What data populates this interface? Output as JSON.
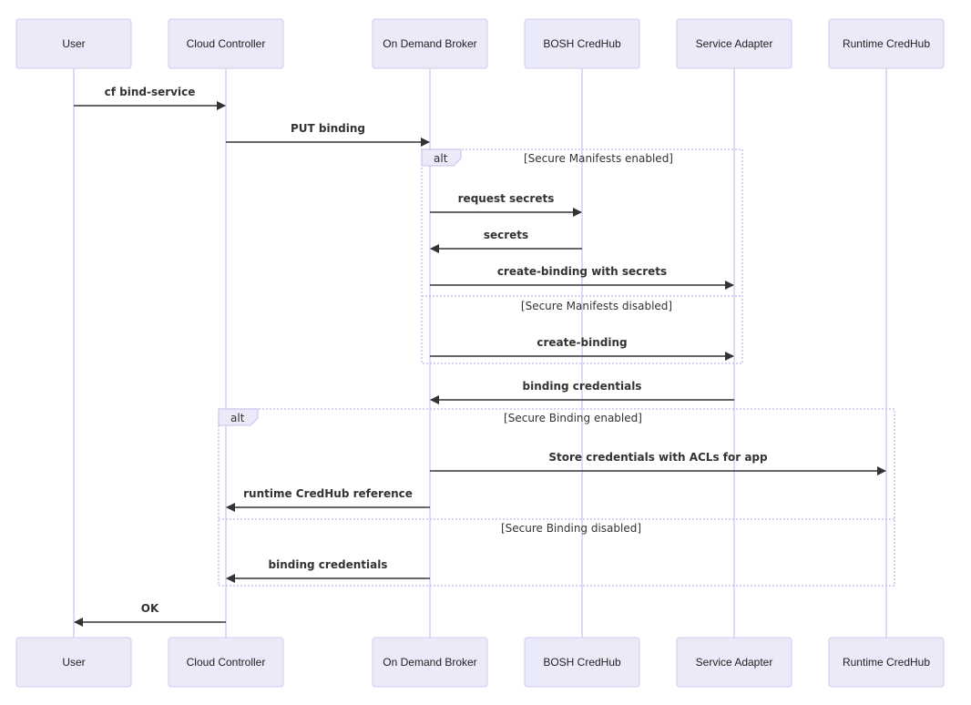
{
  "actors": [
    "User",
    "Cloud Controller",
    "On Demand Broker",
    "BOSH CredHub",
    "Service Adapter",
    "Runtime CredHub"
  ],
  "messages": [
    {
      "from": 0,
      "to": 1,
      "text": "cf bind-service"
    },
    {
      "from": 1,
      "to": 2,
      "text": "PUT binding"
    },
    {
      "from": 2,
      "to": 3,
      "text": "request secrets"
    },
    {
      "from": 3,
      "to": 2,
      "text": "secrets"
    },
    {
      "from": 2,
      "to": 4,
      "text": "create-binding with secrets"
    },
    {
      "from": 2,
      "to": 4,
      "text": "create-binding"
    },
    {
      "from": 4,
      "to": 2,
      "text": "binding credentials"
    },
    {
      "from": 2,
      "to": 5,
      "text": "Store credentials with ACLs for app"
    },
    {
      "from": 2,
      "to": 1,
      "text": "runtime CredHub reference"
    },
    {
      "from": 2,
      "to": 1,
      "text": "binding credentials"
    },
    {
      "from": 1,
      "to": 0,
      "text": "OK"
    }
  ],
  "alt_blocks": [
    {
      "label": "alt",
      "conditions": [
        "[Secure Manifests enabled]",
        "[Secure Manifests disabled]"
      ]
    },
    {
      "label": "alt",
      "conditions": [
        "[Secure Binding enabled]",
        "[Secure Binding disabled]"
      ]
    }
  ],
  "colors": {
    "actor_fill": "#eaeaf8",
    "actor_border": "#ccccf0",
    "lifeline": "#c9c2ee",
    "message": "#333333"
  }
}
